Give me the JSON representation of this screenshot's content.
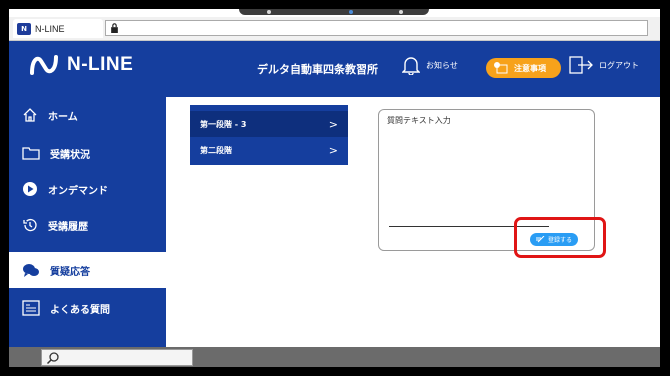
{
  "browser": {
    "tab_label": "N-LINE",
    "tab_logo": "N"
  },
  "header": {
    "brand": "N-LINE",
    "school": "デルタ自動車四条教習所",
    "notice_label": "お知らせ",
    "caution_label": "注意事項",
    "logout_label": "ログアウト",
    "colors": {
      "primary": "#153e9e",
      "caution": "#f7a21b",
      "accent": "#2a9df4",
      "highlight": "#e01515"
    }
  },
  "sidebar": {
    "items": [
      {
        "label": "ホーム",
        "icon": "home-icon"
      },
      {
        "label": "受講状況",
        "icon": "folder-icon"
      },
      {
        "label": "オンデマンド",
        "icon": "play-icon"
      },
      {
        "label": "受講履歴",
        "icon": "history-icon"
      },
      {
        "label": "質疑応答",
        "icon": "chat-icon",
        "active": true
      },
      {
        "label": "よくある質問",
        "icon": "qa-icon"
      }
    ]
  },
  "main": {
    "stages": [
      {
        "label": "第一段階 - 3",
        "chevron": ">"
      },
      {
        "label": "第二段階",
        "chevron": ">"
      }
    ],
    "question": {
      "placeholder": "質問テキスト入力",
      "submit_label": "登録する"
    }
  }
}
